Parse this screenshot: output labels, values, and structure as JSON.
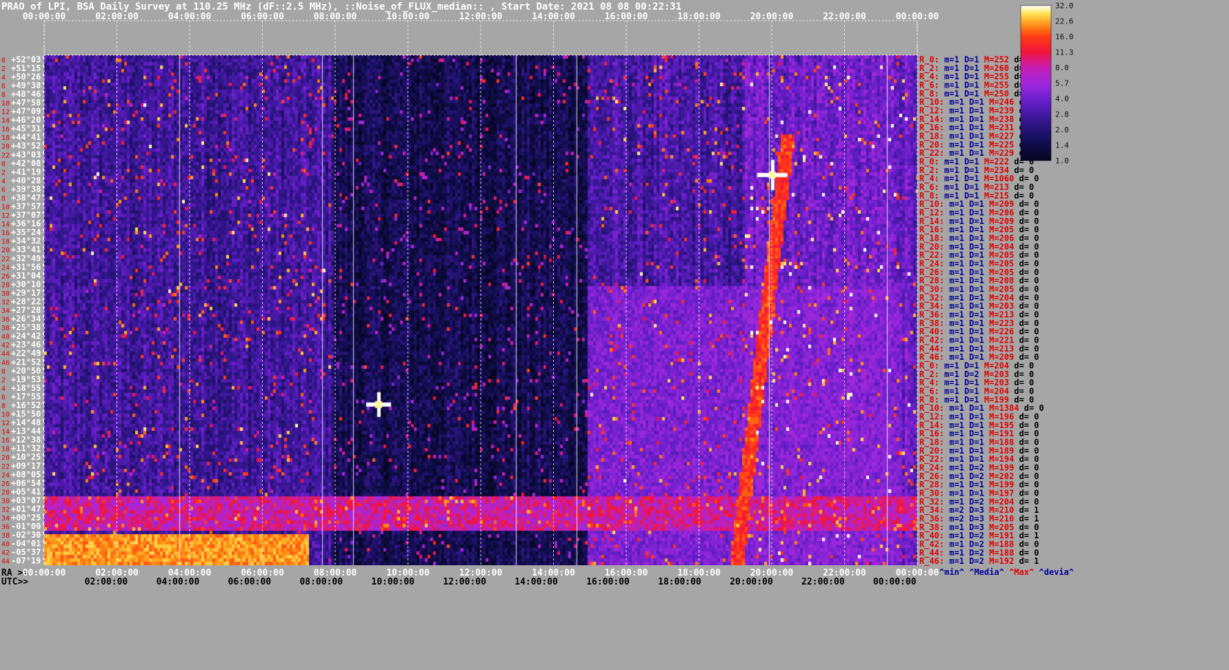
{
  "title": "PRAO of LPI, BSA Daily Survey at 110.25 MHz (dF::2.5 MHz), ::Noise_of_FLUX_median:: , Start Date: 2021 08 08 00:22:31",
  "chart_data": {
    "type": "heatmap",
    "x_top_ticks": [
      "00:00:00",
      "02:00:00",
      "04:00:00",
      "06:00:00",
      "08:00:00",
      "10:00:00",
      "12:00:00",
      "14:00:00",
      "16:00:00",
      "18:00:00",
      "20:00:00",
      "22:00:00",
      "00:00:00"
    ],
    "x_bottom_ra_ticks": [
      "00:00:00",
      "02:00:00",
      "04:00:00",
      "06:00:00",
      "08:00:00",
      "10:00:00",
      "12:00:00",
      "14:00:00",
      "16:00:00",
      "18:00:00",
      "20:00:00",
      "22:00:00",
      "00:00:00"
    ],
    "x_bottom_utc_ticks": [
      "02:00:00",
      "04:00:00",
      "06:00:00",
      "08:00:00",
      "10:00:00",
      "12:00:00",
      "14:00:00",
      "16:00:00",
      "18:00:00",
      "20:00:00",
      "22:00:00",
      "00:00:00"
    ],
    "ra_label": "RA >>",
    "utc_label": "UTC>>",
    "declinations": [
      "+52°03'",
      "+51°15'",
      "+50°26'",
      "+49°38'",
      "+48°46'",
      "+47°58'",
      "+47°09'",
      "+46°20'",
      "+45°31'",
      "+44°41'",
      "+43°52'",
      "+43°03'",
      "+42°08'",
      "+41°19'",
      "+40°28'",
      "+39°38'",
      "+38°47'",
      "+37°57'",
      "+37°07'",
      "+36°16'",
      "+35°24'",
      "+34°32'",
      "+33°41'",
      "+32°49'",
      "+31°56'",
      "+31°04'",
      "+30°10'",
      "+29°17'",
      "+28°22'",
      "+27°28'",
      "+26°34'",
      "+25°38'",
      "+24°42'",
      "+23°46'",
      "+22°49'",
      "+21°52'",
      "+20°50'",
      "+19°53'",
      "+18°55'",
      "+17°55'",
      "+16°52'",
      "+15°50'",
      "+14°48'",
      "+13°44'",
      "+12°38'",
      "+11°32'",
      "+10°25'",
      "+09°17'",
      "+08°05'",
      "+06°54'",
      "+05°41'",
      "+03°07'",
      "+01°47'",
      "+00°25'",
      "-01°00'",
      "-02°30'",
      "-04°01'",
      "-05°37'",
      "-07°19'"
    ],
    "row_index_labels": [
      "0",
      "2",
      "4",
      "6",
      "8",
      "10",
      "12",
      "14",
      "16",
      "18",
      "20",
      "22",
      "0",
      "2",
      "4",
      "6",
      "8",
      "10",
      "12",
      "14",
      "16",
      "18",
      "20",
      "22",
      "24",
      "26",
      "28",
      "30",
      "32",
      "34",
      "36",
      "38",
      "40",
      "42",
      "44",
      "46",
      "0",
      "2",
      "4",
      "6",
      "8",
      "10",
      "12",
      "14",
      "16",
      "18",
      "20",
      "22",
      "24",
      "26",
      "28",
      "30",
      "32",
      "34",
      "36",
      "38",
      "40",
      "42",
      "44",
      "46"
    ],
    "stats": [
      {
        "r": "R_0:",
        "m": "m=1",
        "D": "D=1",
        "M": "M=252",
        "d": "d= 0"
      },
      {
        "r": "R_2:",
        "m": "m=1",
        "D": "D=1",
        "M": "M=260",
        "d": "d= 0"
      },
      {
        "r": "R_4:",
        "m": "m=1",
        "D": "D=1",
        "M": "M=255",
        "d": "d= 0"
      },
      {
        "r": "R_6:",
        "m": "m=1",
        "D": "D=1",
        "M": "M=255",
        "d": "d= 0"
      },
      {
        "r": "R_8:",
        "m": "m=1",
        "D": "D=1",
        "M": "M=250",
        "d": "d= 0"
      },
      {
        "r": "R_10:",
        "m": "m=1",
        "D": "D=1",
        "M": "M=246",
        "d": "d= 0"
      },
      {
        "r": "R_12:",
        "m": "m=1",
        "D": "D=1",
        "M": "M=239",
        "d": "d="
      },
      {
        "r": "R_14:",
        "m": "m=1",
        "D": "D=1",
        "M": "M=238",
        "d": "d="
      },
      {
        "r": "R_16:",
        "m": "m=1",
        "D": "D=1",
        "M": "M=231",
        "d": "d="
      },
      {
        "r": "R_18:",
        "m": "m=1",
        "D": "D=1",
        "M": "M=227",
        "d": "d="
      },
      {
        "r": "R_20:",
        "m": "m=1",
        "D": "D=1",
        "M": "M=225",
        "d": "d="
      },
      {
        "r": "R_22:",
        "m": "m=1",
        "D": "D=1",
        "M": "M=229",
        "d": "d="
      },
      {
        "r": "R_0:",
        "m": "m=1",
        "D": "D=1",
        "M": "M=222",
        "d": "d= 0"
      },
      {
        "r": "R_2:",
        "m": "m=1",
        "D": "D=1",
        "M": "M=234",
        "d": "d= 0"
      },
      {
        "r": "R_4:",
        "m": "m=1",
        "D": "D=1",
        "M": "M=1060",
        "d": "d= 0"
      },
      {
        "r": "R_6:",
        "m": "m=1",
        "D": "D=1",
        "M": "M=213",
        "d": "d= 0"
      },
      {
        "r": "R_8:",
        "m": "m=1",
        "D": "D=1",
        "M": "M=215",
        "d": "d= 0"
      },
      {
        "r": "R_10:",
        "m": "m=1",
        "D": "D=1",
        "M": "M=209",
        "d": "d= 0"
      },
      {
        "r": "R_12:",
        "m": "m=1",
        "D": "D=1",
        "M": "M=206",
        "d": "d= 0"
      },
      {
        "r": "R_14:",
        "m": "m=1",
        "D": "D=1",
        "M": "M=209",
        "d": "d= 0"
      },
      {
        "r": "R_16:",
        "m": "m=1",
        "D": "D=1",
        "M": "M=205",
        "d": "d= 0"
      },
      {
        "r": "R_18:",
        "m": "m=1",
        "D": "D=1",
        "M": "M=206",
        "d": "d= 0"
      },
      {
        "r": "R_20:",
        "m": "m=1",
        "D": "D=1",
        "M": "M=204",
        "d": "d= 0"
      },
      {
        "r": "R_22:",
        "m": "m=1",
        "D": "D=1",
        "M": "M=205",
        "d": "d= 0"
      },
      {
        "r": "R_24:",
        "m": "m=1",
        "D": "D=1",
        "M": "M=205",
        "d": "d= 0"
      },
      {
        "r": "R_26:",
        "m": "m=1",
        "D": "D=1",
        "M": "M=205",
        "d": "d= 0"
      },
      {
        "r": "R_28:",
        "m": "m=1",
        "D": "D=1",
        "M": "M=208",
        "d": "d= 0"
      },
      {
        "r": "R_30:",
        "m": "m=1",
        "D": "D=1",
        "M": "M=205",
        "d": "d= 0"
      },
      {
        "r": "R_32:",
        "m": "m=1",
        "D": "D=1",
        "M": "M=204",
        "d": "d= 0"
      },
      {
        "r": "R_34:",
        "m": "m=1",
        "D": "D=1",
        "M": "M=203",
        "d": "d= 0"
      },
      {
        "r": "R_36:",
        "m": "m=1",
        "D": "D=1",
        "M": "M=213",
        "d": "d= 0"
      },
      {
        "r": "R_38:",
        "m": "m=1",
        "D": "D=1",
        "M": "M=223",
        "d": "d= 0"
      },
      {
        "r": "R_40:",
        "m": "m=1",
        "D": "D=1",
        "M": "M=226",
        "d": "d= 0"
      },
      {
        "r": "R_42:",
        "m": "m=1",
        "D": "D=1",
        "M": "M=221",
        "d": "d= 0"
      },
      {
        "r": "R_44:",
        "m": "m=1",
        "D": "D=1",
        "M": "M=213",
        "d": "d= 0"
      },
      {
        "r": "R_46:",
        "m": "m=1",
        "D": "D=1",
        "M": "M=209",
        "d": "d= 0"
      },
      {
        "r": "R_0:",
        "m": "m=1",
        "D": "D=1",
        "M": "M=204",
        "d": "d= 0"
      },
      {
        "r": "R_2:",
        "m": "m=1",
        "D": "D=2",
        "M": "M=203",
        "d": "d= 0"
      },
      {
        "r": "R_4:",
        "m": "m=1",
        "D": "D=1",
        "M": "M=203",
        "d": "d= 0"
      },
      {
        "r": "R_6:",
        "m": "m=1",
        "D": "D=1",
        "M": "M=204",
        "d": "d= 0"
      },
      {
        "r": "R_8:",
        "m": "m=1",
        "D": "D=1",
        "M": "M=199",
        "d": "d= 0"
      },
      {
        "r": "R_10:",
        "m": "m=1",
        "D": "D=1",
        "M": "M=1384",
        "d": "d= 0"
      },
      {
        "r": "R_12:",
        "m": "m=1",
        "D": "D=1",
        "M": "M=196",
        "d": "d= 0"
      },
      {
        "r": "R_14:",
        "m": "m=1",
        "D": "D=1",
        "M": "M=195",
        "d": "d= 0"
      },
      {
        "r": "R_16:",
        "m": "m=1",
        "D": "D=1",
        "M": "M=191",
        "d": "d= 0"
      },
      {
        "r": "R_18:",
        "m": "m=1",
        "D": "D=1",
        "M": "M=188",
        "d": "d= 0"
      },
      {
        "r": "R_20:",
        "m": "m=1",
        "D": "D=1",
        "M": "M=189",
        "d": "d= 0"
      },
      {
        "r": "R_22:",
        "m": "m=1",
        "D": "D=1",
        "M": "M=194",
        "d": "d= 0"
      },
      {
        "r": "R_24:",
        "m": "m=1",
        "D": "D=2",
        "M": "M=199",
        "d": "d= 0"
      },
      {
        "r": "R_26:",
        "m": "m=1",
        "D": "D=2",
        "M": "M=202",
        "d": "d= 0"
      },
      {
        "r": "R_28:",
        "m": "m=1",
        "D": "D=1",
        "M": "M=199",
        "d": "d= 0"
      },
      {
        "r": "R_30:",
        "m": "m=1",
        "D": "D=1",
        "M": "M=197",
        "d": "d= 0"
      },
      {
        "r": "R_32:",
        "m": "m=1",
        "D": "D=2",
        "M": "M=204",
        "d": "d= 0"
      },
      {
        "r": "R_34:",
        "m": "m=2",
        "D": "D=3",
        "M": "M=210",
        "d": "d= 1"
      },
      {
        "r": "R_36:",
        "m": "m=2",
        "D": "D=3",
        "M": "M=210",
        "d": "d= 1"
      },
      {
        "r": "R_38:",
        "m": "m=1",
        "D": "D=3",
        "M": "M=205",
        "d": "d= 0"
      },
      {
        "r": "R_40:",
        "m": "m=1",
        "D": "D=2",
        "M": "M=191",
        "d": "d= 1"
      },
      {
        "r": "R_42:",
        "m": "m=1",
        "D": "D=2",
        "M": "M=188",
        "d": "d= 0"
      },
      {
        "r": "R_44:",
        "m": "m=1",
        "D": "D=2",
        "M": "M=188",
        "d": "d= 0"
      },
      {
        "r": "R_46:",
        "m": "m=1",
        "D": "D=2",
        "M": "M=192",
        "d": "d= 1"
      }
    ],
    "legend_footer": [
      {
        "text": "^min^",
        "color": "#000099"
      },
      {
        "text": "^Media^",
        "color": "#000099"
      },
      {
        "text": "^Max^",
        "color": "#e00000"
      },
      {
        "text": "^devia^",
        "color": "#000099"
      }
    ],
    "colorbar_ticks": [
      "32.0",
      "22.6",
      "16.0",
      "11.3",
      "8.0",
      "5.7",
      "4.0",
      "2.8",
      "2.0",
      "1.4",
      "1.0"
    ],
    "colorbar_scale": "log",
    "colorbar_range": [
      1.0,
      32.0
    ],
    "colors": {
      "background": "#a6a6a6",
      "low": "#0a0830",
      "mid": "#6a1fc8",
      "high": "#ff1818",
      "max": "#ffffff"
    }
  }
}
